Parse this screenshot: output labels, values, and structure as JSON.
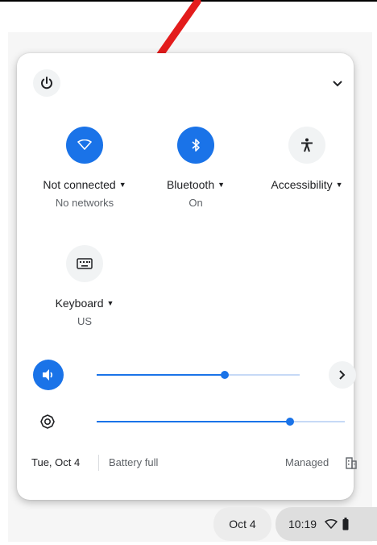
{
  "quick_settings": {
    "tiles": [
      {
        "label": "Not connected",
        "sublabel": "No networks",
        "icon": "wifi-icon"
      },
      {
        "label": "Bluetooth",
        "sublabel": "On",
        "icon": "bluetooth-icon"
      },
      {
        "label": "Accessibility",
        "sublabel": "",
        "icon": "accessibility-icon"
      },
      {
        "label": "Keyboard",
        "sublabel": "US",
        "icon": "keyboard-icon"
      }
    ],
    "volume_level": 0.63,
    "brightness_level": 0.78
  },
  "footer": {
    "date": "Tue, Oct 4",
    "battery": "Battery full",
    "managed": "Managed"
  },
  "shelf": {
    "date": "Oct 4",
    "time": "10:19"
  },
  "colors": {
    "accent": "#1a73e8",
    "annotation_arrow": "#e31c1c"
  }
}
